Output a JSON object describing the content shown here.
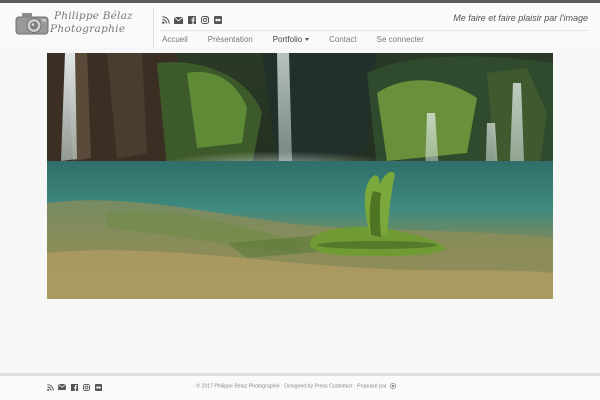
{
  "site": {
    "logo_line1": "Philippe Bélaz",
    "logo_line2": "Photographie",
    "tagline": "Me faire et faire plaisir par l'image"
  },
  "social_icons": [
    "rss-icon",
    "envelope-icon",
    "facebook-icon",
    "instagram-icon",
    "flickr-icon"
  ],
  "nav": {
    "items": [
      {
        "label": "Accueil"
      },
      {
        "label": "Présentation"
      },
      {
        "label": "Portfolio"
      },
      {
        "label": "Contact"
      },
      {
        "label": "Se connecter"
      }
    ]
  },
  "footer": {
    "credits": "· © 2017 Philippe Bélaz Photographie · Designed by Press Customizr · Propulsé par"
  },
  "colors": {
    "top_bar": "#5a5a5a",
    "background": "#f7f7f7",
    "icon": "#555555"
  }
}
